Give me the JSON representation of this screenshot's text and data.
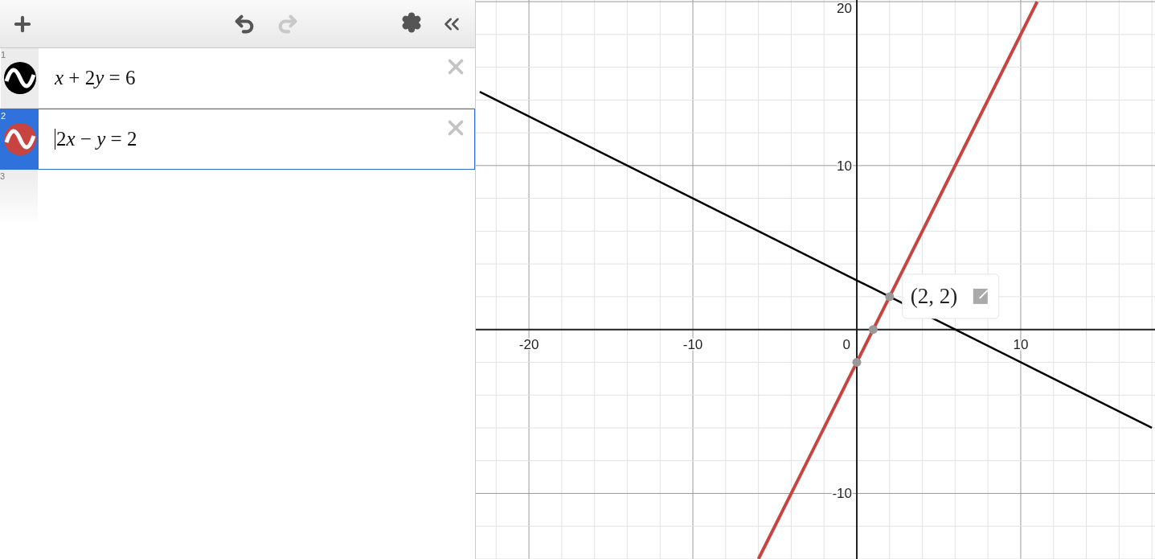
{
  "toolbar": {
    "undo": {
      "disabled": false
    },
    "redo": {
      "disabled": true
    }
  },
  "expressions": [
    {
      "number": "1",
      "text": "x + 2y = 6",
      "color": "#000000",
      "selected": false
    },
    {
      "number": "2",
      "text": "2x − y = 2",
      "color": "#c74440",
      "selected": true
    }
  ],
  "new_row": {
    "number": "3"
  },
  "graph": {
    "origin_label": "0",
    "chart_data": {
      "type": "line",
      "grid": true,
      "x": [
        -23,
        -6,
        0,
        1,
        2,
        11,
        18
      ],
      "xlim": [
        -23.24,
        18.19
      ],
      "ylim": [
        -14,
        20.1
      ],
      "xticks": [
        -20,
        -10,
        10
      ],
      "yticks": [
        -10,
        10,
        20
      ],
      "series": [
        {
          "color": "#000000",
          "values": [
            14.5,
            6,
            3,
            2.5,
            2,
            -2.5,
            -6
          ]
        },
        {
          "color": "#c74440",
          "values": [
            null,
            -14,
            -2,
            0,
            2,
            20,
            null
          ]
        },
        {
          "color": "#999999",
          "marker": "circle",
          "values": [
            null,
            null,
            -2,
            null,
            null,
            null,
            null
          ]
        },
        {
          "color": "#999999",
          "marker": "circle",
          "values": [
            null,
            null,
            null,
            0,
            null,
            null,
            null
          ]
        },
        {
          "color": "#999999",
          "marker": "circle",
          "values": [
            null,
            null,
            null,
            null,
            2,
            null,
            null
          ]
        }
      ],
      "annotations": [
        {
          "x": 2,
          "y": 2,
          "text": "(2, 2)"
        }
      ]
    }
  }
}
